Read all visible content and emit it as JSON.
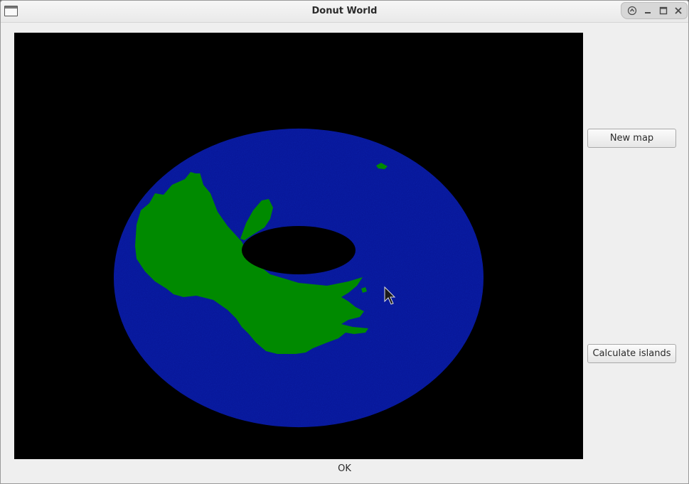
{
  "window": {
    "title": "Donut World",
    "controls": [
      "shade-up-icon",
      "minimize-icon",
      "maximize-icon",
      "close-icon"
    ]
  },
  "map": {
    "ocean_color": "#0a1fa8",
    "land_color": "#008a00",
    "background_color": "#000000"
  },
  "buttons": {
    "new_map": "New map",
    "calculate_islands": "Calculate islands"
  },
  "status": {
    "text": "OK"
  }
}
